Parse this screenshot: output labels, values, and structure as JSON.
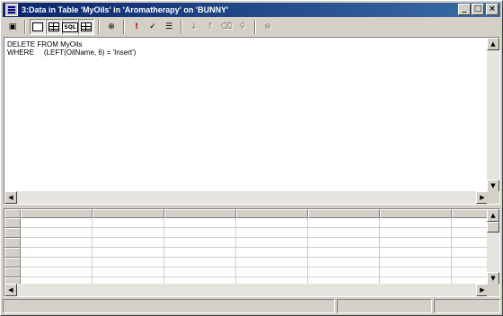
{
  "window": {
    "title": "3:Data in Table 'MyOils' in 'Aromatherapy' on 'BUNNY'",
    "buttons": {
      "minimize": "_",
      "maximize": "□",
      "close": "×"
    }
  },
  "toolbar": {
    "icons": {
      "properties": "▣",
      "run": "!",
      "verify_sql": "✓",
      "remove_filter": "⌫",
      "sort_asc": "↓",
      "sort_desc": "↑",
      "filter": "⚲",
      "group_by": "☰",
      "add_table": "⊕",
      "sql_label": "SQL"
    }
  },
  "sql": {
    "text": "DELETE FROM MyOils\nWHERE     (LEFT(OilName, 6) = 'Insert')"
  },
  "grid": {
    "columns": [
      "",
      "",
      "",
      "",
      "",
      "",
      ""
    ],
    "row_count": 7
  },
  "scroll_arrows": {
    "up": "▲",
    "down": "▼",
    "left": "◀",
    "right": "▶"
  }
}
